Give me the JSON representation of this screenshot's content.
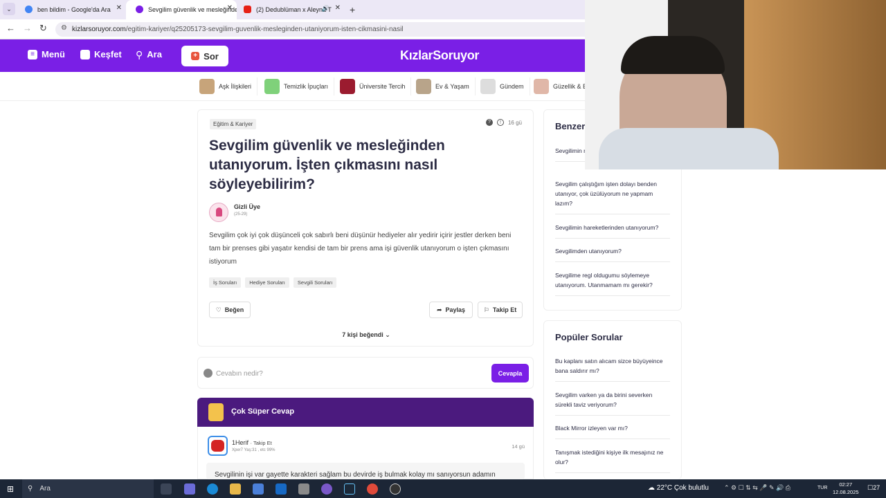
{
  "browser": {
    "tabs": [
      {
        "title": "ben bildim - Google'da Ara",
        "active": false,
        "favicon_color": "#4285f4"
      },
      {
        "title": "Sevgilim güvenlik ve mesleğinde",
        "active": true,
        "favicon_color": "#7a1fe6"
      },
      {
        "title": "(2) Dedublüman x Aleyna T",
        "active": false,
        "favicon_color": "#e62117"
      }
    ],
    "new_tab_label": "+",
    "url_domain": "kizlarsoruyor.com",
    "url_path": "/egitim-kariyer/q25205173-sevgilim-guvenlik-mesleginden-utaniyorum-isten-cikmasini-nasil"
  },
  "site_header": {
    "menu_label": "Menü",
    "explore_label": "Keşfet",
    "search_label": "Ara",
    "ask_label": "Sor",
    "logo_text": "KızlarSoruyor",
    "brand_color": "#7a1fe6"
  },
  "categories": [
    {
      "label": "Aşk İlişkileri",
      "color": "#c7a47a"
    },
    {
      "label": "Temizlik İpuçları",
      "color": "#7fd17a"
    },
    {
      "label": "Üniversite Tercih",
      "color": "#9b1b2f"
    },
    {
      "label": "Ev & Yaşam",
      "color": "#b8a48a"
    },
    {
      "label": "Gündem",
      "color": "#dddddd"
    },
    {
      "label": "Güzellik & B",
      "color": "#e0b7a8"
    }
  ],
  "question": {
    "category": "Eğitim & Kariyer",
    "time_ago": "16 gü",
    "title": "Sevgilim güvenlik ve mesleğinden utanıyorum. İşten çıkmasını nasıl söyleyebilirim?",
    "author_name": "Gizli Üye",
    "author_age": "(25-29)",
    "body": "Sevgilim çok iyi çok düşünceli çok sabırlı beni düşünür hediyeler alır yedirir içirir jestler derken beni tam bir prenses gibi yaşatır kendisi de tam bir prens ama işi güvenlik utanıyorum o işten çıkmasını istiyorum",
    "tags": [
      "İş Soruları",
      "Hediye Soruları",
      "Sevgili Soruları"
    ],
    "like_label": "Beğen",
    "share_label": "Paylaş",
    "follow_label": "Takip Et",
    "likes_summary": "7 kişi beğendi"
  },
  "answer_box": {
    "placeholder": "Cevabın nedir?",
    "submit_label": "Cevapla"
  },
  "best_answer": {
    "header": "Çok Süper Cevap",
    "author": "1Herif",
    "follow_label": "Takip Et",
    "meta": "Xper7 Yaş:31 , etc 99%",
    "time_ago": "14 gü",
    "body": "Sevgilinin işi var gayette karakteri sağlam bu devirde iş bulmak kolay mı sanıyorsun adamın"
  },
  "similar": {
    "title": "Benzer",
    "items": [
      "Sevgilimin mesleğinden utanıyorum",
      "Sevgilim çalıştığım işten dolayı benden utanıyor, çok üzülüyorum ne yapmam lazım?",
      "Sevgilimin hareketlerinden utanıyorum?",
      "Sevgilimden utanıyorum?",
      "Sevgilime regl oldugumu söylemeye utanıyorum. Utanmamam mı gerekir?"
    ]
  },
  "popular": {
    "title": "Popüler Sorular",
    "items": [
      "Bu kaplanı satın alıcam sizce büyüyeince bana saldırır mı?",
      "Sevgilim varken ya da birini severken sürekli taviz veriyorum?",
      "Black Mirror izleyen var mı?",
      "Tanışmak istediğini kişiye ilk mesajınız ne olur?"
    ]
  },
  "taskbar": {
    "search_label": "Ara",
    "weather": "22°C  Çok bulutlu",
    "language": "TUR",
    "time": "02:27",
    "date": "12.08.2025",
    "notifications": "27"
  }
}
